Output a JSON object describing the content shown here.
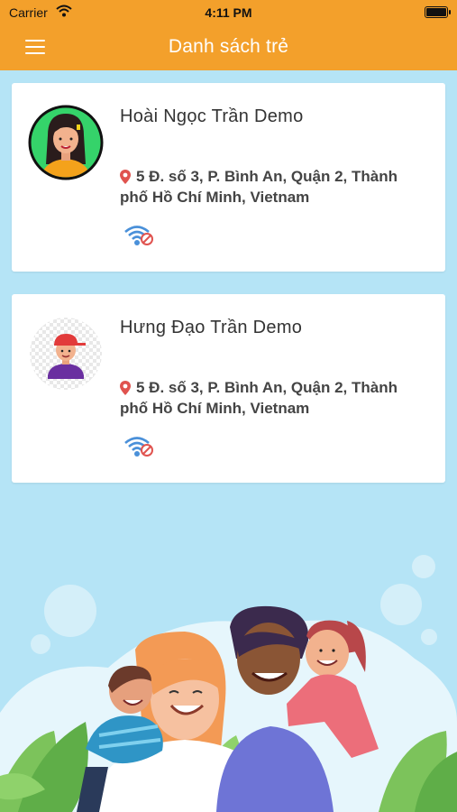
{
  "status_bar": {
    "carrier": "Carrier",
    "time": "4:11 PM"
  },
  "nav": {
    "title": "Danh sách trẻ",
    "menu_icon": "hamburger-menu-icon"
  },
  "children": [
    {
      "name": "Hoài Ngọc Trần Demo",
      "address_line1": "5 Đ. số 3, P. Bình An, Quận 2, Thành",
      "address_line2": "phố Hồ Chí Minh, Vietnam",
      "avatar_icon": "girl-avatar-icon",
      "status_icon": "wifi-disconnected-icon"
    },
    {
      "name": "Hưng Đạo Trần Demo",
      "address_line1": "5 Đ. số 3, P. Bình An, Quận 2, Thành",
      "address_line2": "phố Hồ Chí Minh, Vietnam",
      "avatar_icon": "boy-avatar-icon",
      "status_icon": "wifi-disconnected-icon"
    }
  ],
  "colors": {
    "header": "#f3a02b",
    "background": "#b5e4f6",
    "pin": "#e0534f",
    "wifi": "#4a90d9",
    "no_signal": "#e0534f"
  }
}
